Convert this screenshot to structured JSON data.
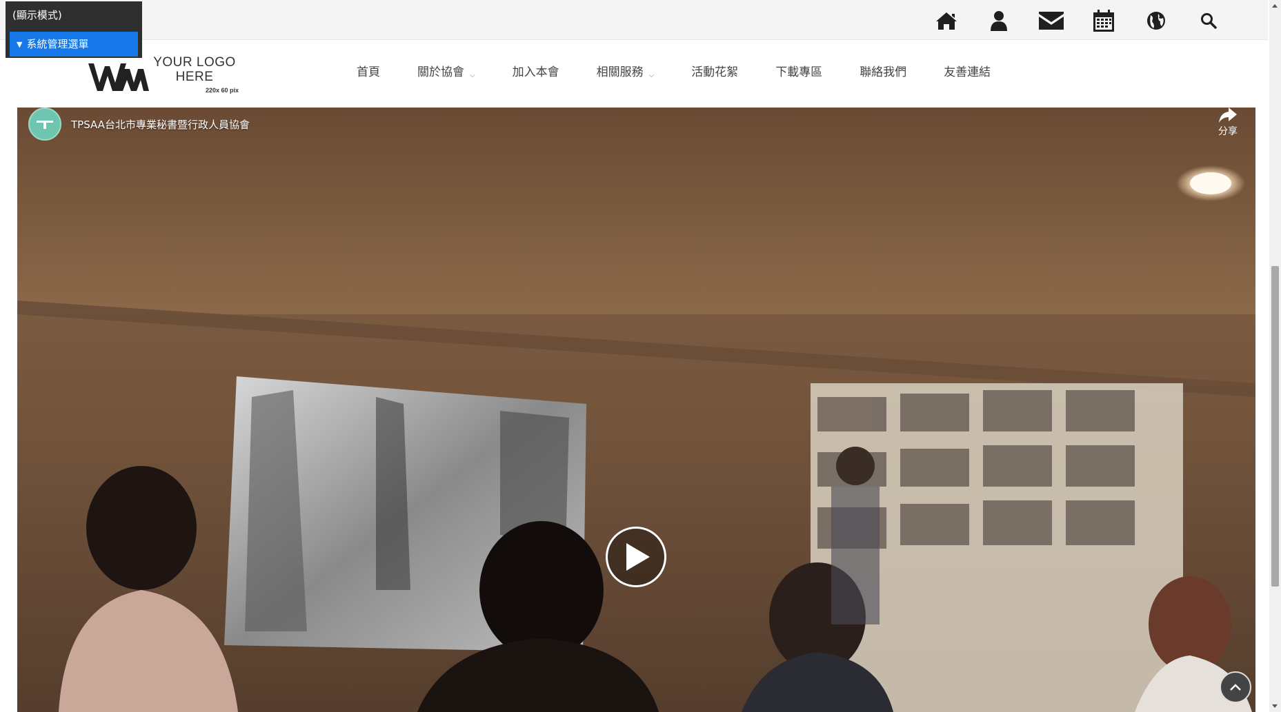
{
  "admin": {
    "mode_label": "(顯示模式)",
    "menu_label": "系統管理選單"
  },
  "topbar": {
    "icons": [
      "home-icon",
      "user-icon",
      "mail-icon",
      "calendar-icon",
      "globe-icon",
      "search-icon"
    ]
  },
  "logo": {
    "mark": "WM",
    "line1": "YOUR LOGO",
    "line2": "HERE",
    "size_note": "220x 60 pix"
  },
  "nav": {
    "items": [
      {
        "label": "首頁",
        "has_dropdown": false
      },
      {
        "label": "關於協會",
        "has_dropdown": true
      },
      {
        "label": "加入本會",
        "has_dropdown": false
      },
      {
        "label": "相關服務",
        "has_dropdown": true
      },
      {
        "label": "活動花絮",
        "has_dropdown": false
      },
      {
        "label": "下載專區",
        "has_dropdown": false
      },
      {
        "label": "聯絡我們",
        "has_dropdown": false
      },
      {
        "label": "友善連結",
        "has_dropdown": false
      }
    ]
  },
  "video": {
    "channel_name": "TPSAA台北市專業秘書暨行政人員協會",
    "share_label": "分享"
  },
  "colors": {
    "admin_bg": "#2f2f2f",
    "admin_accent": "#1677e8",
    "topbar_bg": "#f4f4f4",
    "nav_text": "#444444"
  }
}
